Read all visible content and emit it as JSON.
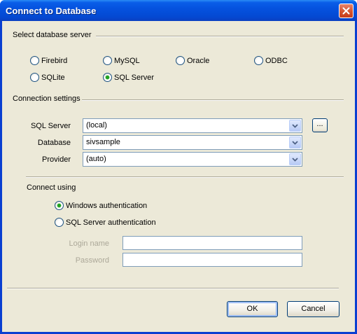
{
  "window": {
    "title": "Connect to Database"
  },
  "server_group": {
    "label": "Select database server",
    "options": [
      {
        "label": "Firebird",
        "checked": false
      },
      {
        "label": "MySQL",
        "checked": false
      },
      {
        "label": "Oracle",
        "checked": false
      },
      {
        "label": "ODBC",
        "checked": false
      },
      {
        "label": "SQLite",
        "checked": false
      },
      {
        "label": "SQL Server",
        "checked": true
      }
    ]
  },
  "connection_group": {
    "label": "Connection settings",
    "sql_server_label": "SQL Server",
    "sql_server_value": "(local)",
    "browse_label": "...",
    "database_label": "Database",
    "database_value": "sivsample",
    "provider_label": "Provider",
    "provider_value": "(auto)"
  },
  "auth_group": {
    "label": "Connect using",
    "windows_auth": {
      "label": "Windows authentication",
      "checked": true
    },
    "sql_auth": {
      "label": "SQL Server authentication",
      "checked": false
    },
    "login_label": "Login name",
    "login_value": "",
    "password_label": "Password",
    "password_value": ""
  },
  "buttons": {
    "ok": "OK",
    "cancel": "Cancel"
  },
  "colors": {
    "titlebar": "#0552df",
    "face": "#ece9d8",
    "close": "#d4542f"
  }
}
